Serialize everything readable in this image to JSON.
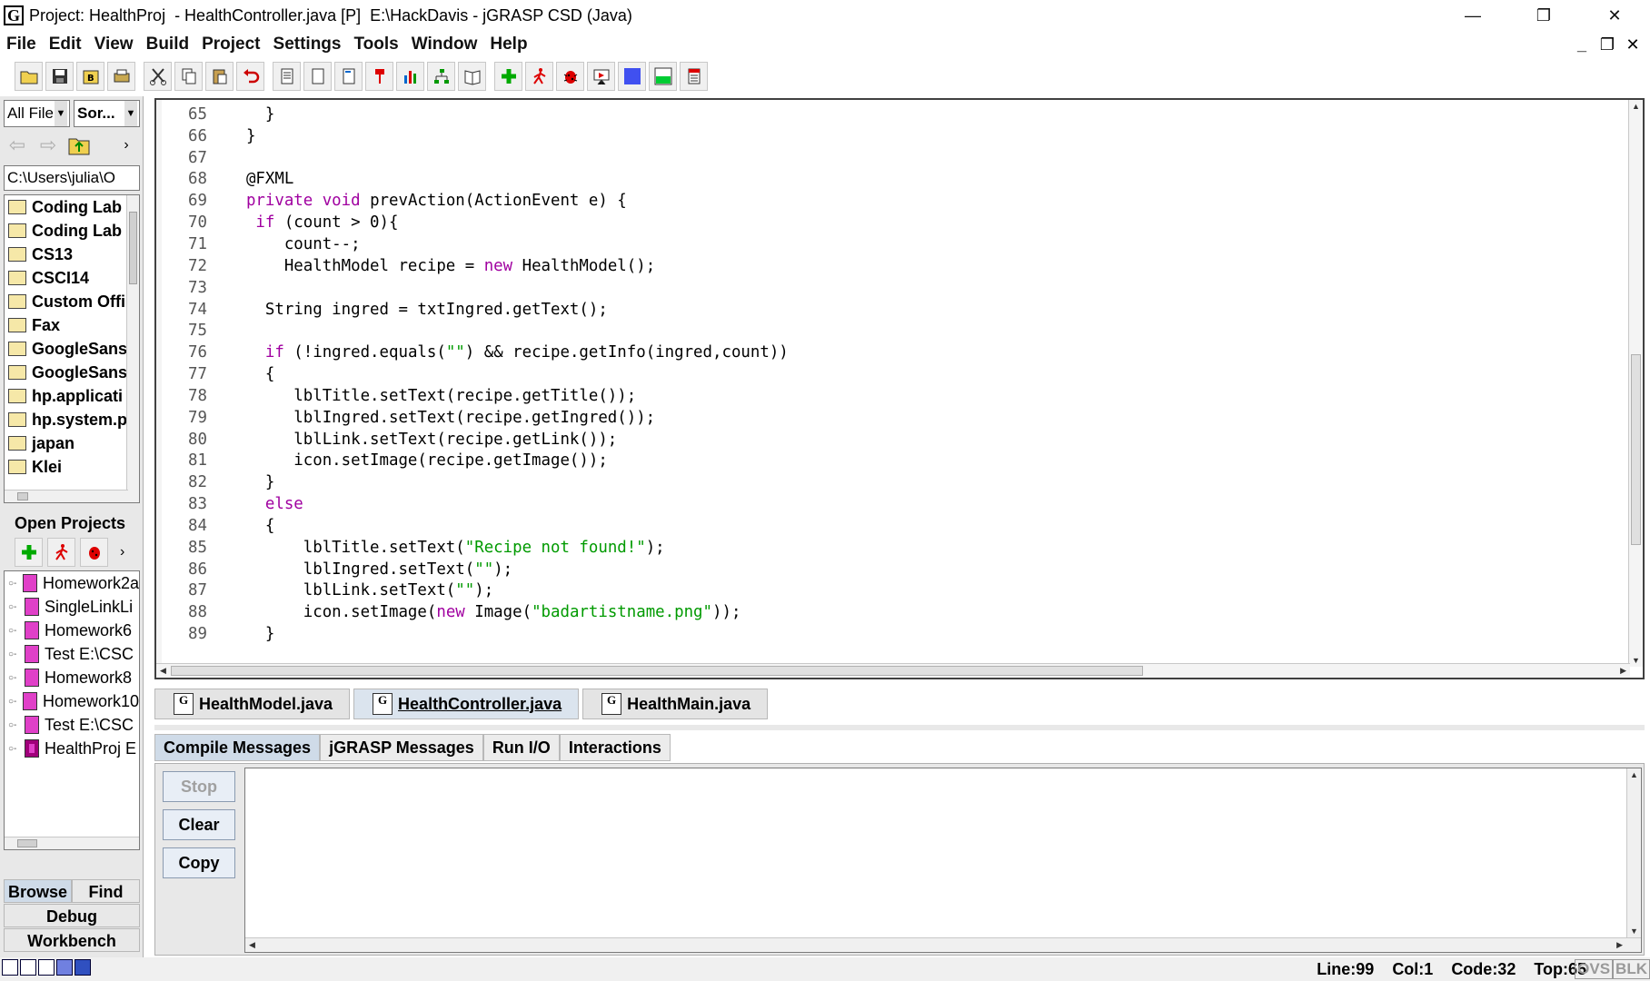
{
  "window": {
    "title": "Project: HealthProj  - HealthController.java [P]  E:\\HackDavis - jGRASP CSD (Java)",
    "app_icon_letter": "G",
    "controls": [
      "—",
      "❐",
      "✕"
    ]
  },
  "menubar": {
    "items": [
      "File",
      "Edit",
      "View",
      "Build",
      "Project",
      "Settings",
      "Tools",
      "Window",
      "Help"
    ]
  },
  "toolbar": {
    "buttons": [
      "open-folder-icon",
      "save-icon",
      "save-all-icon",
      "print-icon",
      "cut-icon",
      "copy-icon",
      "paste-icon",
      "undo-icon",
      "new-file-icon",
      "new-blank-icon",
      "browse-icon",
      "pin-icon",
      "bar-chart-icon",
      "uml-diagram-icon",
      "book-icon",
      "add-icon",
      "run-icon",
      "debug-icon",
      "viewer-icon",
      "blue-square-icon",
      "split-window-icon",
      "document-icon"
    ]
  },
  "browse": {
    "filter_combo": "All File",
    "sort_combo": "Sor...",
    "path": "C:\\Users\\julia\\O",
    "folders": [
      "Coding Lab",
      "Coding Lab",
      "CS13",
      "CSCI14",
      "Custom Offi",
      "Fax",
      "GoogleSans",
      "GoogleSans",
      "hp.applicati",
      "hp.system.p",
      "japan",
      "Klei"
    ]
  },
  "open_projects": {
    "title": "Open Projects",
    "items": [
      "Homework2a",
      "SingleLinkLi",
      "Homework6",
      "Test  E:\\CSC",
      "Homework8",
      "Homework10",
      "Test  E:\\CSC",
      "HealthProj  E"
    ]
  },
  "left_tabs": {
    "browse": "Browse",
    "find": "Find",
    "debug": "Debug",
    "workbench": "Workbench"
  },
  "editor": {
    "lines": [
      {
        "n": "65",
        "parts": [
          [
            "",
            "    }"
          ]
        ]
      },
      {
        "n": "66",
        "parts": [
          [
            "",
            "  }"
          ]
        ]
      },
      {
        "n": "67",
        "parts": [
          [
            "",
            ""
          ]
        ]
      },
      {
        "n": "68",
        "parts": [
          [
            "",
            "  @FXML"
          ]
        ]
      },
      {
        "n": "69",
        "parts": [
          [
            "kw",
            "  private void"
          ],
          [
            "",
            " prevAction(ActionEvent e) {"
          ]
        ]
      },
      {
        "n": "70",
        "parts": [
          [
            "kw",
            "   if"
          ],
          [
            "",
            " (count > 0){"
          ]
        ]
      },
      {
        "n": "71",
        "parts": [
          [
            "",
            "      count--;"
          ]
        ]
      },
      {
        "n": "72",
        "parts": [
          [
            "",
            "      HealthModel recipe = "
          ],
          [
            "kw",
            "new"
          ],
          [
            "",
            " HealthModel();"
          ]
        ]
      },
      {
        "n": "73",
        "parts": [
          [
            "",
            ""
          ]
        ]
      },
      {
        "n": "74",
        "parts": [
          [
            "",
            "    String ingred = txtIngred.getText();"
          ]
        ]
      },
      {
        "n": "75",
        "parts": [
          [
            "",
            ""
          ]
        ]
      },
      {
        "n": "76",
        "parts": [
          [
            "kw",
            "    if"
          ],
          [
            "",
            " (!ingred.equals("
          ],
          [
            "str",
            "\"\""
          ],
          [
            "",
            ") && recipe.getInfo(ingred,count))"
          ]
        ]
      },
      {
        "n": "77",
        "parts": [
          [
            "",
            "    {"
          ]
        ]
      },
      {
        "n": "78",
        "parts": [
          [
            "",
            "       lblTitle.setText(recipe.getTitle());"
          ]
        ]
      },
      {
        "n": "79",
        "parts": [
          [
            "",
            "       lblIngred.setText(recipe.getIngred());"
          ]
        ]
      },
      {
        "n": "80",
        "parts": [
          [
            "",
            "       lblLink.setText(recipe.getLink());"
          ]
        ]
      },
      {
        "n": "81",
        "parts": [
          [
            "",
            "       icon.setImage(recipe.getImage());"
          ]
        ]
      },
      {
        "n": "82",
        "parts": [
          [
            "",
            "    }"
          ]
        ]
      },
      {
        "n": "83",
        "parts": [
          [
            "kw",
            "    else"
          ]
        ]
      },
      {
        "n": "84",
        "parts": [
          [
            "",
            "    {"
          ]
        ]
      },
      {
        "n": "85",
        "parts": [
          [
            "",
            "        lblTitle.setText("
          ],
          [
            "str",
            "\"Recipe not found!\""
          ],
          [
            "",
            ");"
          ]
        ]
      },
      {
        "n": "86",
        "parts": [
          [
            "",
            "        lblIngred.setText("
          ],
          [
            "str",
            "\"\""
          ],
          [
            "",
            ");"
          ]
        ]
      },
      {
        "n": "87",
        "parts": [
          [
            "",
            "        lblLink.setText("
          ],
          [
            "str",
            "\"\""
          ],
          [
            "",
            ");"
          ]
        ]
      },
      {
        "n": "88",
        "parts": [
          [
            "",
            "        icon.setImage("
          ],
          [
            "kw",
            "new"
          ],
          [
            "",
            " Image("
          ],
          [
            "str",
            "\"badartistname.png\""
          ],
          [
            "",
            "));"
          ]
        ]
      },
      {
        "n": "89",
        "parts": [
          [
            "",
            "    }"
          ]
        ]
      }
    ]
  },
  "file_tabs": [
    {
      "label": "HealthModel.java",
      "selected": false
    },
    {
      "label": "HealthController.java",
      "selected": true
    },
    {
      "label": "HealthMain.java",
      "selected": false
    }
  ],
  "messages": {
    "tabs": [
      "Compile Messages",
      "jGRASP Messages",
      "Run I/O",
      "Interactions"
    ],
    "selected_tab": "Compile Messages",
    "buttons": {
      "stop": "Stop",
      "clear": "Clear",
      "copy": "Copy"
    }
  },
  "status": {
    "line": "Line:99",
    "col": "Col:1",
    "code": "Code:32",
    "top": "Top:65",
    "ovs": "OVS",
    "blk": "BLK"
  },
  "colors": {
    "keyword": "#a000a0",
    "string": "#009a00",
    "selected_tab": "#cfdbe8"
  }
}
